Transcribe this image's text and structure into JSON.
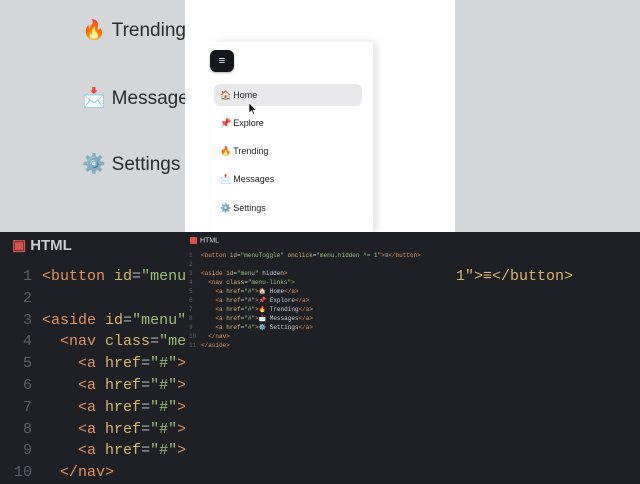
{
  "background": {
    "items": [
      {
        "icon": "🔥",
        "label": "Trending"
      },
      {
        "icon": "📩",
        "label": "Messages"
      },
      {
        "icon": "⚙️",
        "label": "Settings"
      }
    ],
    "editor_title": "HTML",
    "code_lines": [
      {
        "num": "1",
        "text": "<button id=\"menu"
      },
      {
        "num": "2",
        "text": ""
      },
      {
        "num": "3",
        "text": "<aside id=\"menu\""
      },
      {
        "num": "4",
        "text": "  <nav class=\"men"
      },
      {
        "num": "5",
        "text": "    <a href=\"#\">"
      },
      {
        "num": "6",
        "text": "    <a href=\"#\">"
      },
      {
        "num": "7",
        "text": "    <a href=\"#\">"
      },
      {
        "num": "8",
        "text": "    <a href=\"#\">"
      },
      {
        "num": "9",
        "text": "    <a href=\"#\">"
      },
      {
        "num": "10",
        "text": "  </nav>"
      }
    ],
    "code_right": "1\">≡</button>"
  },
  "preview": {
    "toggle_label": "≡",
    "menu_items": [
      {
        "icon": "🏠",
        "label": "Home",
        "active": true
      },
      {
        "icon": "📌",
        "label": "Explore",
        "active": false
      },
      {
        "icon": "🔥",
        "label": "Trending",
        "active": false
      },
      {
        "icon": "📩",
        "label": "Messages",
        "active": false
      },
      {
        "icon": "⚙️",
        "label": "Settings",
        "active": false
      }
    ]
  },
  "editor": {
    "title": "HTML",
    "lines": [
      {
        "num": "1",
        "text": "<button id=\"menuToggle\" onclick=\"menu.hidden ^= 1\">≡</button>"
      },
      {
        "num": "2",
        "text": ""
      },
      {
        "num": "3",
        "text": "<aside id=\"menu\" hidden>"
      },
      {
        "num": "4",
        "text": "  <nav class=\"menu-links\">"
      },
      {
        "num": "5",
        "text": "    <a href=\"#\">🏠 Home</a>"
      },
      {
        "num": "6",
        "text": "    <a href=\"#\">📌 Explore</a>"
      },
      {
        "num": "7",
        "text": "    <a href=\"#\">🔥 Trending</a>"
      },
      {
        "num": "8",
        "text": "    <a href=\"#\">📩 Messages</a>"
      },
      {
        "num": "9",
        "text": "    <a href=\"#\">⚙️ Settings</a>"
      },
      {
        "num": "10",
        "text": "  </nav>"
      },
      {
        "num": "11",
        "text": "</aside>"
      }
    ]
  },
  "colors": {
    "editor_bg": "#1e2026",
    "tag": "#e0935d",
    "attr": "#d6b86a",
    "active_item_bg": "#e9e9ec"
  }
}
